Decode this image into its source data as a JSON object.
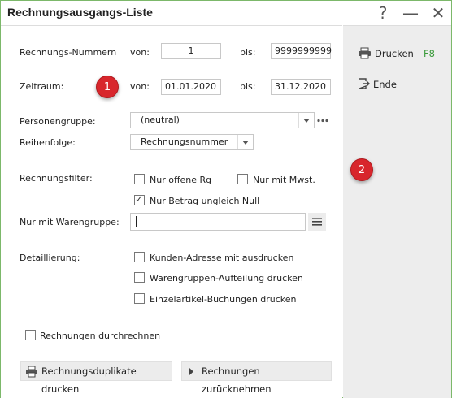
{
  "window": {
    "title": "Rechnungsausgangs-Liste",
    "help_icon": "?",
    "minimize_icon": "—",
    "close_icon": "✕"
  },
  "form": {
    "invoice_numbers_label": "Rechnungs-Nummern",
    "from_label": "von:",
    "to_label": "bis:",
    "invoice_from": "1",
    "invoice_to": "9999999999",
    "period_label": "Zeitraum:",
    "period_from": "01.01.2020",
    "period_to": "31.12.2020",
    "person_group_label": "Personengruppe:",
    "person_group_value": "(neutral)",
    "order_label": "Reihenfolge:",
    "order_value": "Rechnungsnummer",
    "filter_label": "Rechnungsfilter:",
    "only_open": "Nur offene Rg",
    "only_vat": "Nur mit Mwst.",
    "only_nonzero": "Nur Betrag ungleich Null",
    "goods_group_label": "Nur mit Warengruppe:",
    "goods_group_value": "",
    "detail_label": "Detaillierung:",
    "print_customer_address": "Kunden-Adresse mit ausdrucken",
    "print_goods_groups": "Warengruppen-Aufteilung drucken",
    "print_single_items": "Einzelartikel-Buchungen drucken",
    "recalc_invoices": "Rechnungen durchrechnen",
    "print_duplicates_button": "Rechnungsduplikate drucken",
    "revoke_invoices_button": "Rechnungen zurücknehmen"
  },
  "checks": {
    "only_open": false,
    "only_vat": false,
    "only_nonzero": true,
    "print_customer_address": false,
    "print_goods_groups": false,
    "print_single_items": false,
    "recalc_invoices": false
  },
  "side": {
    "print_label": "Drucken",
    "print_shortcut": "F8",
    "end_label": "Ende"
  },
  "badges": {
    "b1": "1",
    "b2": "2"
  },
  "colors": {
    "shortcut": "#3a9a3a",
    "badge": "#d8262c",
    "border": "#7cb86a"
  }
}
